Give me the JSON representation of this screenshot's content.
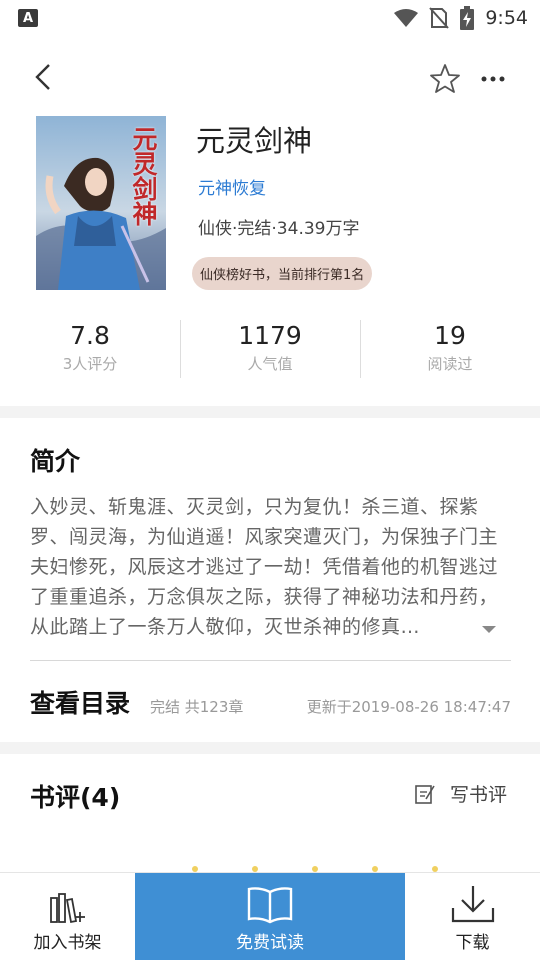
{
  "status_bar": {
    "left_icon": "A",
    "time": "9:54",
    "icons": [
      "wifi-icon",
      "no-sim-icon",
      "battery-charging-icon"
    ]
  },
  "app_bar": {
    "icons": [
      "back-arrow-icon",
      "star-outline-icon",
      "more-dots-icon"
    ]
  },
  "book": {
    "title": "元灵剑神",
    "sub_genre": "元神恢复",
    "meta": "仙侠·完结·34.39万字",
    "rank_badge": "仙侠榜好书，当前排行第1名",
    "cover_text": "元灵剑神"
  },
  "stats": [
    {
      "value": "7.8",
      "label": "3人评分"
    },
    {
      "value": "1179",
      "label": "人气值"
    },
    {
      "value": "19",
      "label": "阅读过"
    }
  ],
  "intro": {
    "title": "简介",
    "text": "入妙灵、斩鬼涯、灭灵剑，只为复仇！杀三道、探紫罗、闯灵海，为仙逍遥！风家突遭灭门，为保独子门主夫妇惨死，风辰这才逃过了一劫！凭借着他的机智逃过了重重追杀，万念俱灰之际，获得了神秘功法和丹药，从此踏上了一条万人敬仰，灭世杀神的修真…"
  },
  "catalog": {
    "title": "查看目录",
    "count": "完结 共123章",
    "updated": "更新于2019-08-26 18:47:47"
  },
  "reviews": {
    "title": "书评(4)",
    "write_label": "写书评"
  },
  "bottom_bar": {
    "shelf_label": "加入书架",
    "read_label": "免费试读",
    "download_label": "下载"
  },
  "colors": {
    "accent": "#3f8fd4",
    "link": "#2c7bd3",
    "badge_bg": "#e9d5cd"
  }
}
